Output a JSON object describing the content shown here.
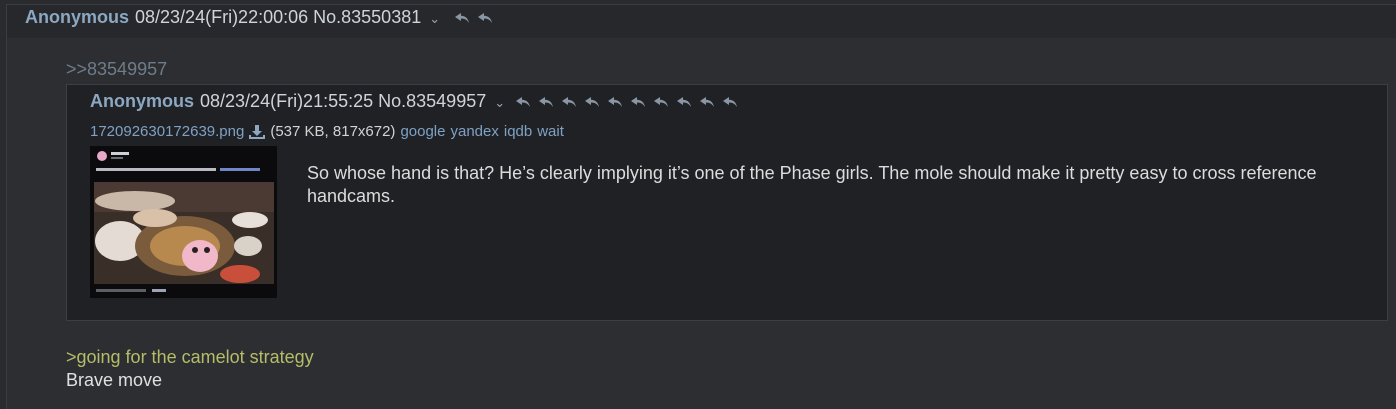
{
  "main_post": {
    "name": "Anonymous",
    "datetime": "08/23/24(Fri)22:00:06",
    "post_no": "No.83550381",
    "menu_icon": "chevron-down-icon",
    "reply_icon": "reply-arrow-icon"
  },
  "quote_link": ">>83549957",
  "quoted_post": {
    "name": "Anonymous",
    "datetime": "08/23/24(Fri)21:55:25",
    "post_no": "No.83549957",
    "menu_icon": "chevron-down-icon",
    "reply_icon": "reply-arrow-icon",
    "file": {
      "filename": "172092630172639.png",
      "download_icon": "download-icon",
      "info": "(537 KB, 817x672)",
      "search_links": [
        "google",
        "yandex",
        "iqdb",
        "wait"
      ]
    },
    "message": "So whose hand is that? He’s clearly implying it’s one of the Phase girls. The mole should make it pretty easy to cross reference handcams."
  },
  "reply_greentext": ">going for the camelot strategy",
  "reply_text": "Brave move",
  "colors": {
    "background": "#2a2b2e",
    "name": "#8ca7c2",
    "link": "#7fa1c4",
    "quotelink": "#6f7c89",
    "greentext": "#b5bd68"
  }
}
